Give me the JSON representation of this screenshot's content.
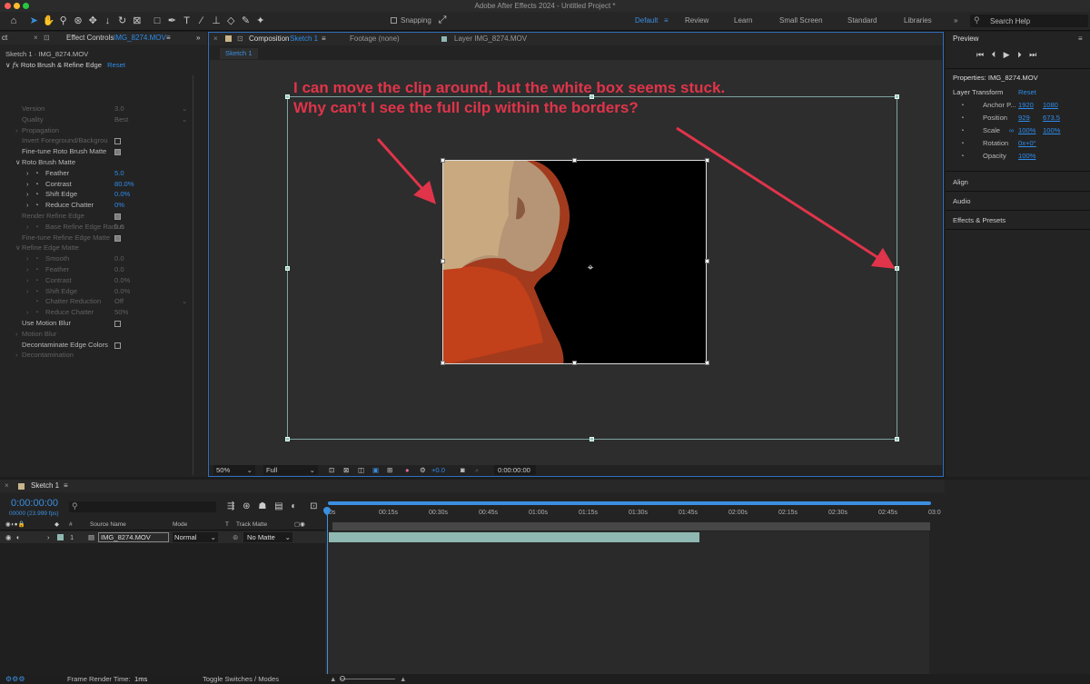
{
  "window": {
    "title": "Adobe After Effects 2024 - Untitled Project *"
  },
  "toolbar": {
    "snapping_label": "Snapping",
    "workspaces": [
      "Default",
      "Review",
      "Learn",
      "Small Screen",
      "Standard",
      "Libraries"
    ],
    "search_placeholder": "Search Help"
  },
  "effect_panel": {
    "tab_label": "Effect Controls",
    "tab_layer": "IMG_8274.MOV",
    "breadcrumb": "Sketch 1 · IMG_8274.MOV",
    "effect_name": "Roto Brush & Refine Edge",
    "reset_label": "Reset",
    "rows": [
      {
        "label": "Version",
        "value": "3.0",
        "dim": true
      },
      {
        "label": "Quality",
        "value": "Best",
        "dim": true
      },
      {
        "label": "Propagation",
        "value": "",
        "dim": true
      },
      {
        "label": "Invert Foreground/Backgrou",
        "value": "",
        "dim": true
      },
      {
        "label": "Fine-tune Roto Brush Matte",
        "value": "",
        "dim": false
      },
      {
        "label": "Roto Brush Matte",
        "value": "",
        "dim": false
      },
      {
        "label": "Feather",
        "value": "5.0",
        "dim": false
      },
      {
        "label": "Contrast",
        "value": "80.0%",
        "dim": false
      },
      {
        "label": "Shift Edge",
        "value": "0.0%",
        "dim": false
      },
      {
        "label": "Reduce Chatter",
        "value": "0%",
        "dim": false
      },
      {
        "label": "Render Refine Edge",
        "value": "",
        "dim": true
      },
      {
        "label": "Base Refine Edge Radius",
        "value": "0.0",
        "dim": true
      },
      {
        "label": "Fine-tune Refine Edge Matte",
        "value": "",
        "dim": true
      },
      {
        "label": "Refine Edge Matte",
        "value": "",
        "dim": true
      },
      {
        "label": "Smooth",
        "value": "0.0",
        "dim": true
      },
      {
        "label": "Feather",
        "value": "0.0",
        "dim": true
      },
      {
        "label": "Contrast",
        "value": "0.0%",
        "dim": true
      },
      {
        "label": "Shift Edge",
        "value": "0.0%",
        "dim": true
      },
      {
        "label": "Chatter Reduction",
        "value": "Off",
        "dim": true
      },
      {
        "label": "Reduce Chatter",
        "value": "50%",
        "dim": true
      },
      {
        "label": "Use Motion Blur",
        "value": "",
        "dim": false
      },
      {
        "label": "Motion Blur",
        "value": "",
        "dim": true
      },
      {
        "label": "Decontaminate Edge Colors",
        "value": "",
        "dim": false
      },
      {
        "label": "Decontamination",
        "value": "",
        "dim": true
      }
    ]
  },
  "composition": {
    "tab_label": "Composition",
    "tab_name": "Sketch 1",
    "footage_tab": "Footage (none)",
    "layer_tab": "Layer IMG_8274.MOV",
    "subtab": "Sketch 1",
    "annotation_line1": "I can move the clip around, but the white box seems stuck.",
    "annotation_line2": "Why can’t I see the full cilp within the borders?",
    "zoom": "50%",
    "resolution": "Full",
    "exposure": "+0.0",
    "timecode": "0:00:00:00"
  },
  "right_panel": {
    "preview_label": "Preview",
    "properties_label": "Properties: IMG_8274.MOV",
    "layer_transform_label": "Layer Transform",
    "reset_label": "Reset",
    "props": [
      {
        "label": "Anchor P...",
        "v1": "1920",
        "v2": "1080"
      },
      {
        "label": "Position",
        "v1": "929",
        "v2": "673.5"
      },
      {
        "label": "Scale",
        "v1": "100%",
        "v2": "100%"
      },
      {
        "label": "Rotation",
        "v1": "0x+0°",
        "v2": ""
      },
      {
        "label": "Opacity",
        "v1": "100%",
        "v2": ""
      }
    ],
    "sections": [
      "Align",
      "Audio",
      "Effects & Presets"
    ]
  },
  "timeline": {
    "tab_label": "Sketch 1",
    "timecode": "0:00:00:00",
    "fps_text": "00000 (23.999 fps)",
    "col_source": "Source Name",
    "col_mode": "Mode",
    "col_t": "T",
    "col_trackmatte": "Track Matte",
    "layer_num": "1",
    "layer_name": "IMG_8274.MOV",
    "layer_mode": "Normal",
    "layer_matte": "No Matte",
    "ticks": [
      "0s",
      "00:15s",
      "00:30s",
      "00:45s",
      "01:00s",
      "01:15s",
      "01:30s",
      "01:45s",
      "02:00s",
      "02:15s",
      "02:30s",
      "02:45s",
      "03:0"
    ]
  },
  "status": {
    "render_label": "Frame Render Time:",
    "render_value": "1ms",
    "toggle_label": "Toggle Switches / Modes"
  },
  "colors": {
    "accent": "#2d8ceb",
    "annotation": "#e0344a",
    "layer_bar": "#8fb8b2"
  }
}
